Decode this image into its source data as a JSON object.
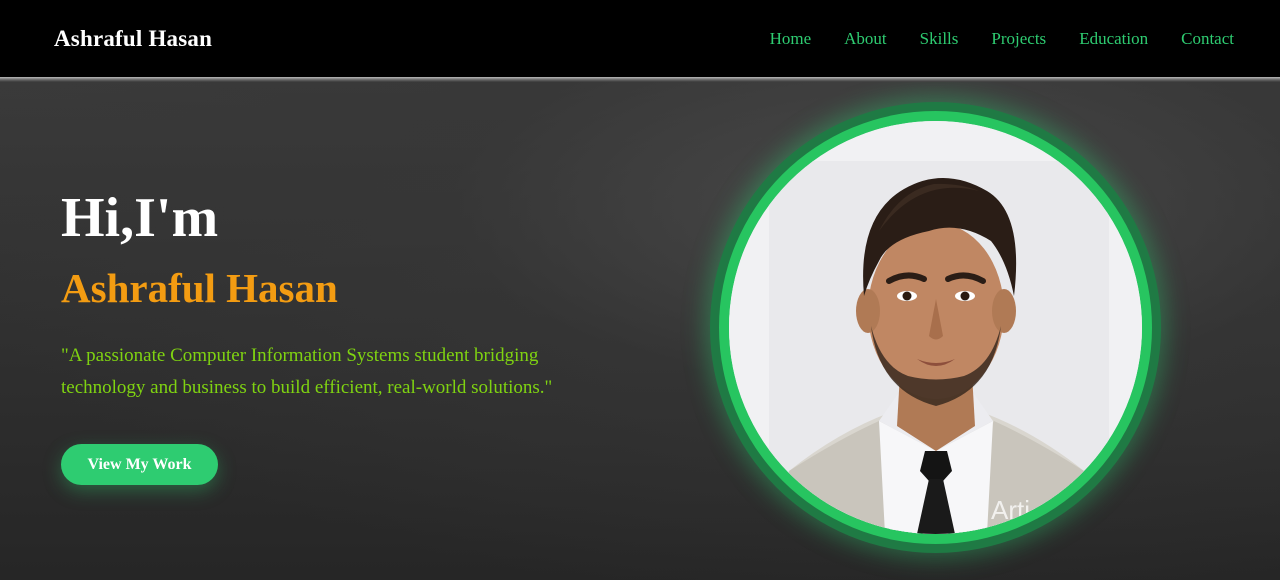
{
  "header": {
    "brand": "Ashraful Hasan",
    "nav": [
      {
        "label": "Home"
      },
      {
        "label": "About"
      },
      {
        "label": "Skills"
      },
      {
        "label": "Projects"
      },
      {
        "label": "Education"
      },
      {
        "label": "Contact"
      }
    ]
  },
  "hero": {
    "greeting": "Hi,I'm",
    "name": "Ashraful Hasan",
    "tagline": "\"A passionate Computer Information Systems student bridging technology and business to build efficient, real-world solutions.\"",
    "cta_label": "View My Work"
  },
  "avatar": {
    "watermark": "Arti"
  },
  "colors": {
    "accent_green": "#2ecc71",
    "name_orange": "#f39c12",
    "tagline_green": "#7fd311",
    "background": "#2b2b2b",
    "navbar": "#000000"
  }
}
